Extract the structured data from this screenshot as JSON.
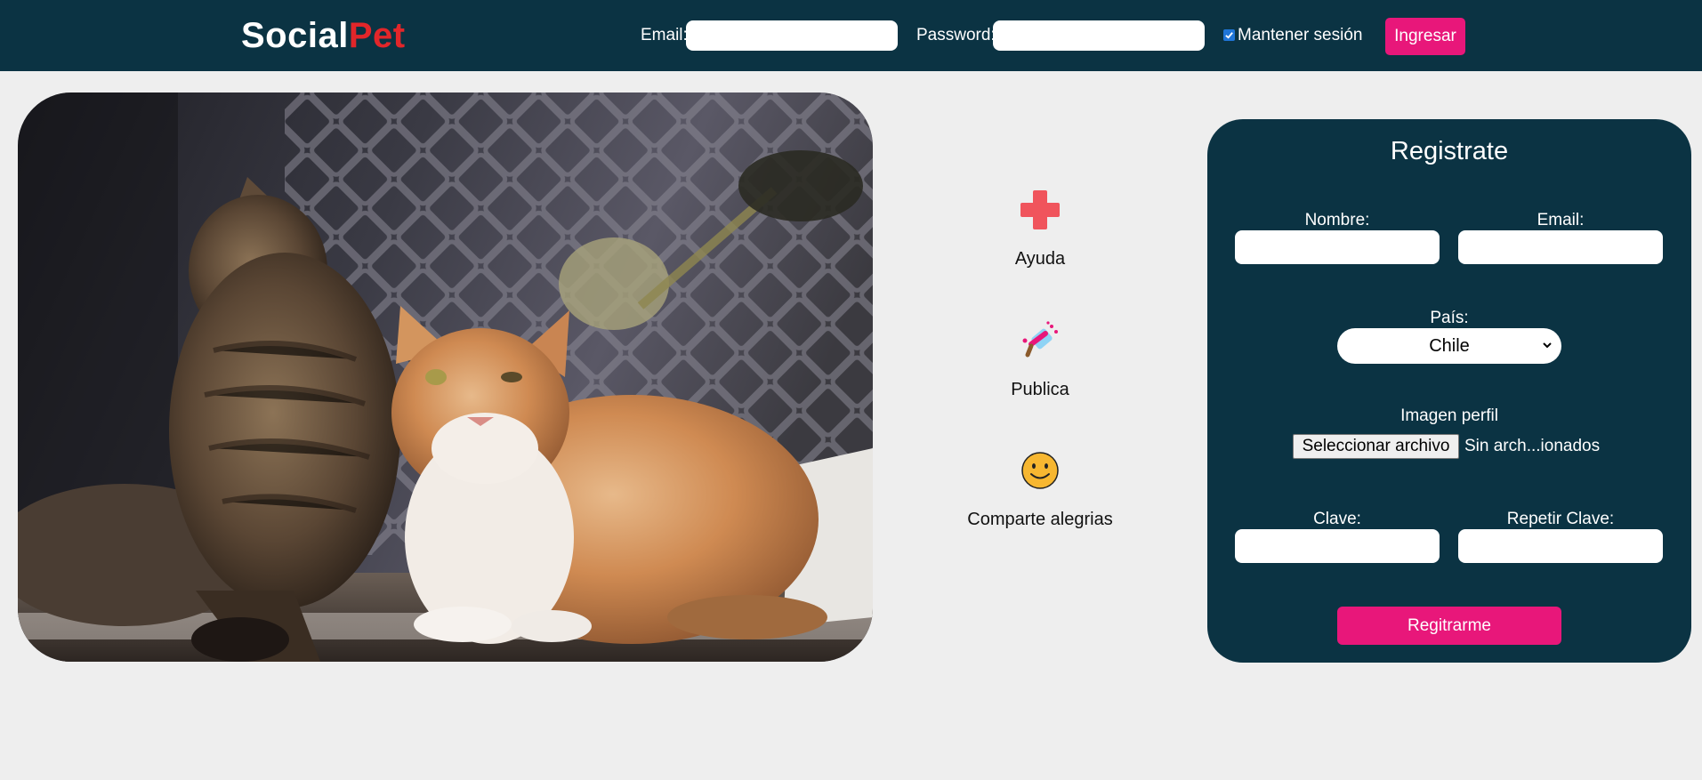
{
  "header": {
    "logo_part1": "Social",
    "logo_part2": "Pet",
    "email_label": "Email:",
    "password_label": "Password:",
    "remember_label": "Mantener sesión",
    "remember_checked": true,
    "login_button": "Ingresar"
  },
  "features": [
    {
      "label": "Ayuda",
      "icon": "red-cross-icon"
    },
    {
      "label": "Publica",
      "icon": "paint-roller-icon"
    },
    {
      "label": "Comparte alegrias",
      "icon": "smiley-icon"
    }
  ],
  "register": {
    "title": "Registrate",
    "name_label": "Nombre:",
    "email_label": "Email:",
    "country_label": "País:",
    "country_selected": "Chile",
    "image_label": "Imagen perfil",
    "file_button": "Seleccionar archivo",
    "file_status": "Sin arch...ionados",
    "password_label": "Clave:",
    "repeat_password_label": "Repetir Clave:",
    "submit_button": "Regitrarme"
  },
  "colors": {
    "header_bg": "#0b3343",
    "accent": "#e8177a",
    "logo_accent": "#e2262a",
    "page_bg": "#eeeeee"
  }
}
